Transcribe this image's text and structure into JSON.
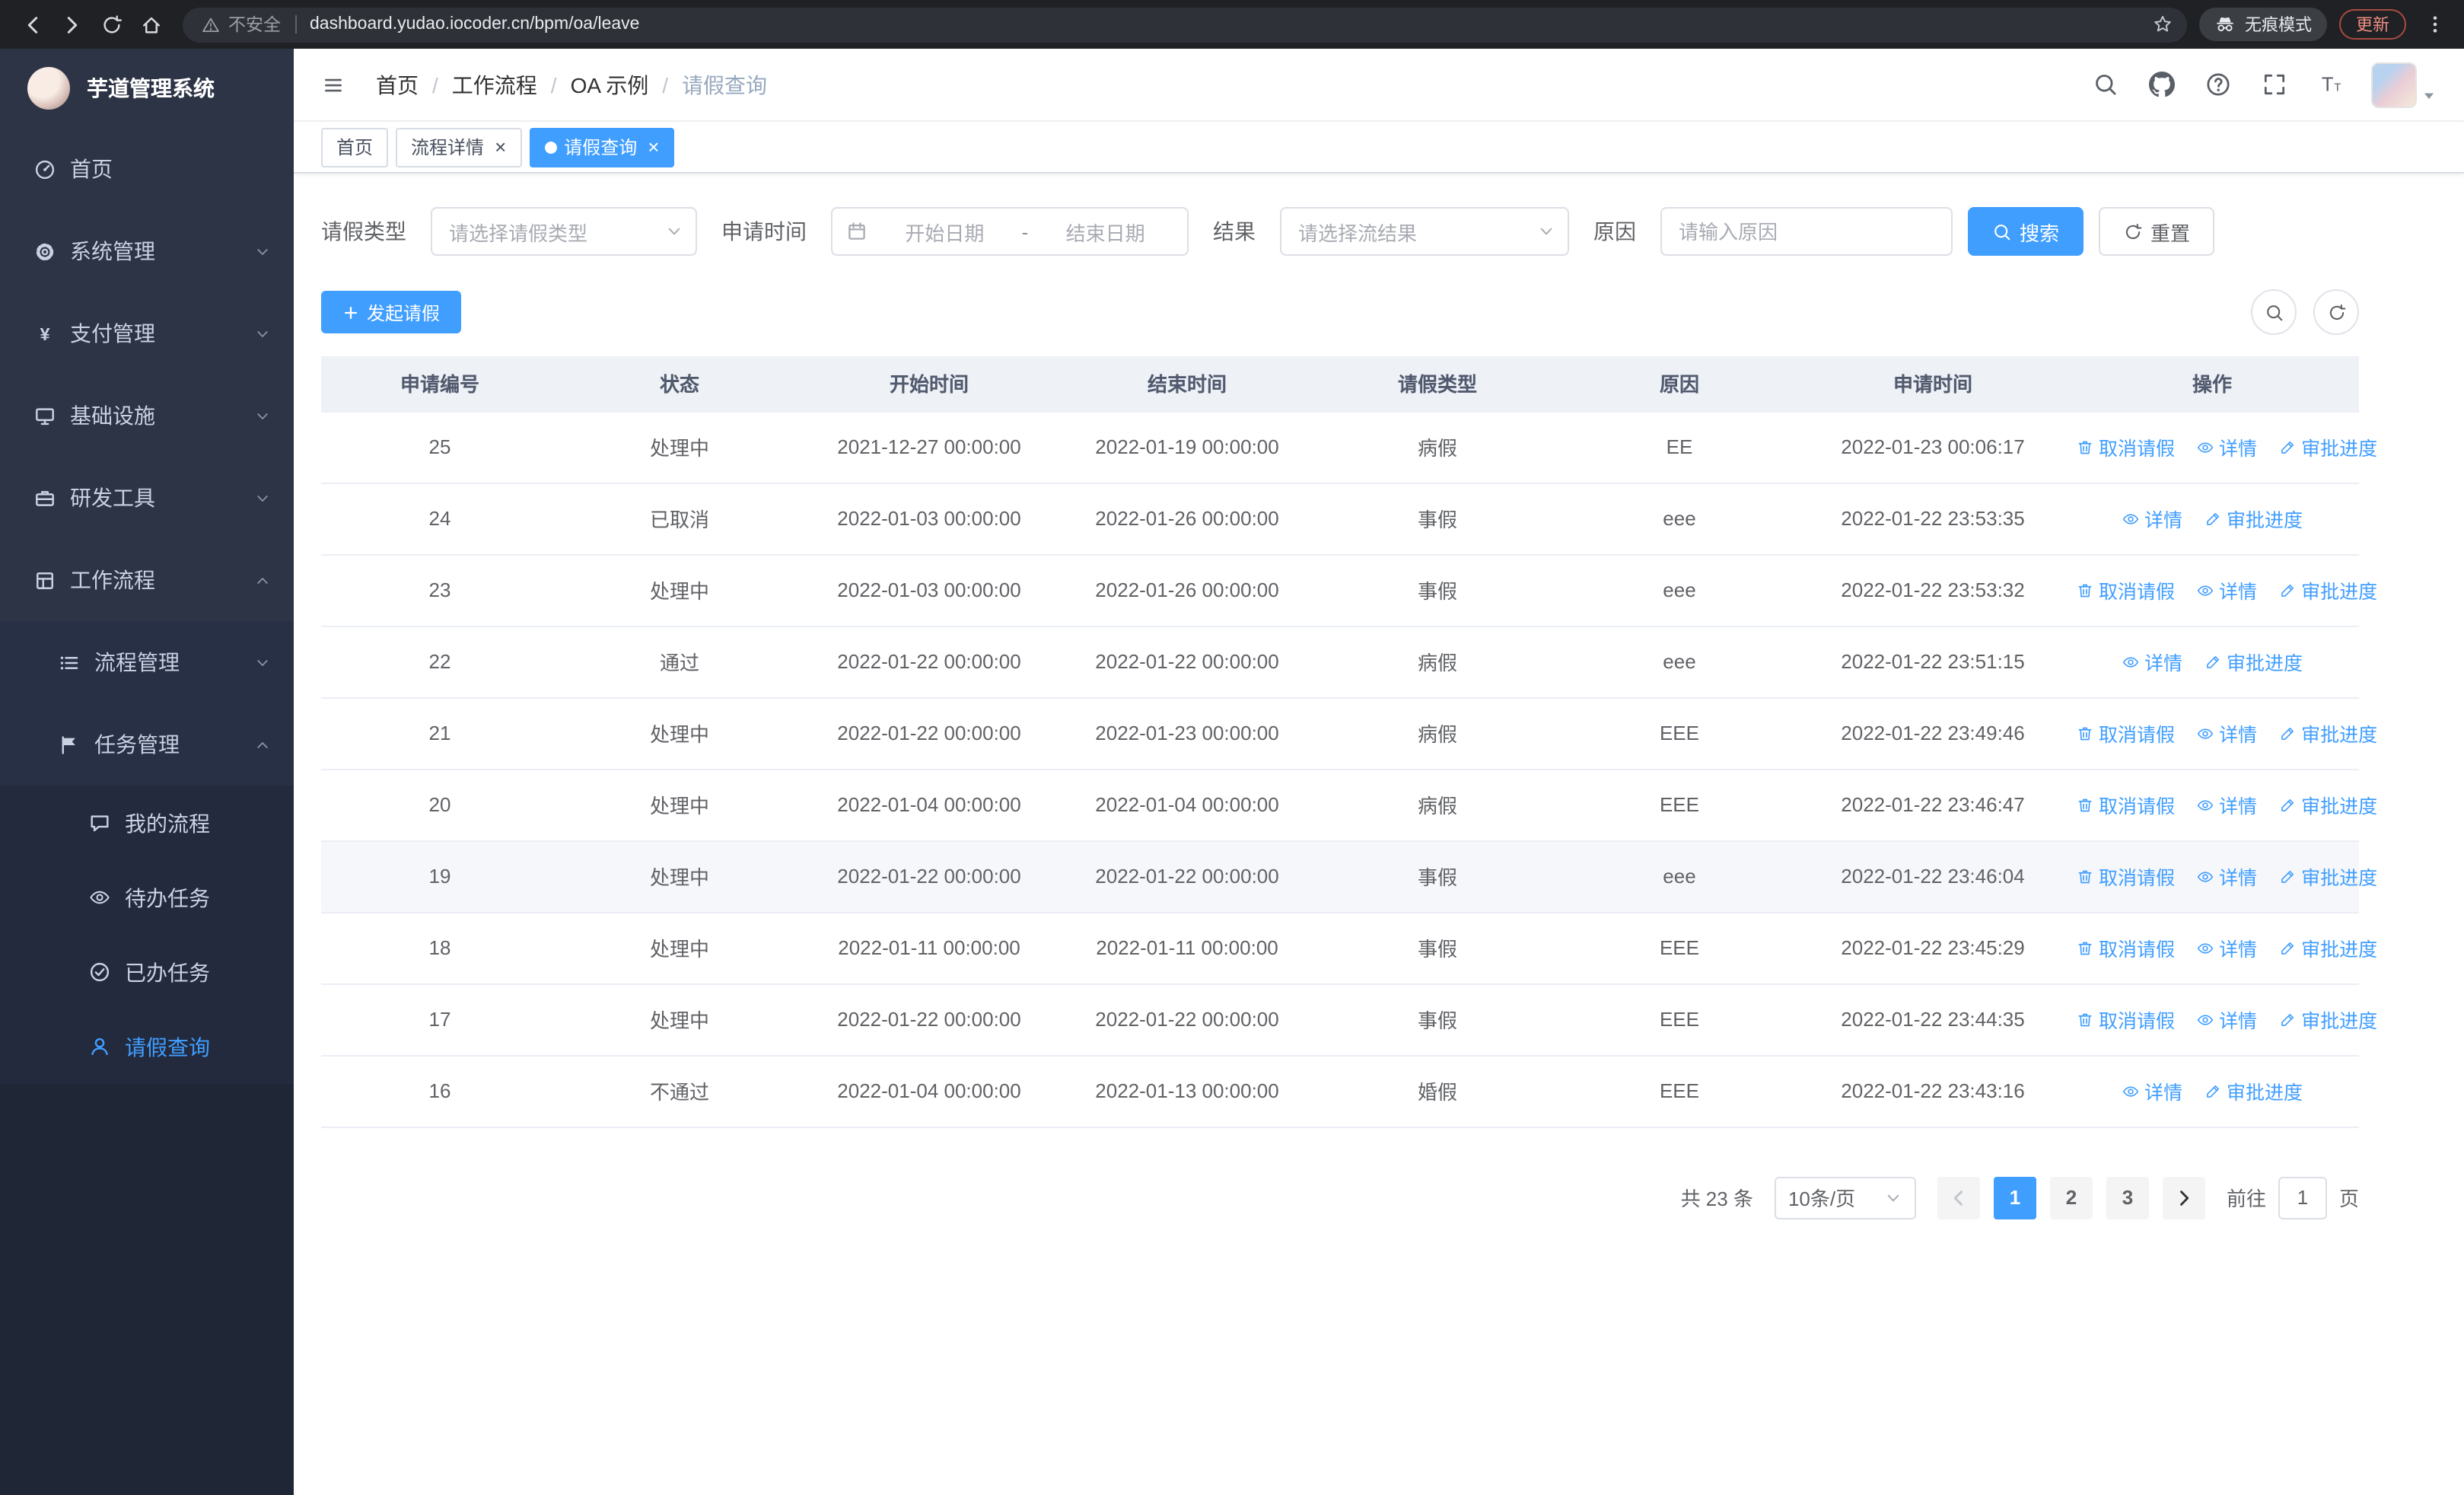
{
  "colors": {
    "primary": "#409eff"
  },
  "browser": {
    "security_label": "不安全",
    "url": "dashboard.yudao.iocoder.cn/bpm/oa/leave",
    "incognito_label": "无痕模式",
    "update_label": "更新"
  },
  "sidebar": {
    "app_title": "芋道管理系统",
    "items": [
      {
        "key": "home",
        "label": "首页",
        "icon": "dashboard-icon",
        "level": 1
      },
      {
        "key": "system",
        "label": "系统管理",
        "icon": "gear-icon",
        "level": 1,
        "chevron": "down"
      },
      {
        "key": "payment",
        "label": "支付管理",
        "icon": "yen-icon",
        "level": 1,
        "chevron": "down"
      },
      {
        "key": "infrastructure",
        "label": "基础设施",
        "icon": "monitor-icon",
        "level": 1,
        "chevron": "down"
      },
      {
        "key": "devtools",
        "label": "研发工具",
        "icon": "briefcase-icon",
        "level": 1,
        "chevron": "down"
      },
      {
        "key": "workflow",
        "label": "工作流程",
        "icon": "grid-icon",
        "level": 1,
        "chevron": "up"
      },
      {
        "key": "process-mgmt",
        "label": "流程管理",
        "icon": "list-icon",
        "level": 2,
        "chevron": "down"
      },
      {
        "key": "task-mgmt",
        "label": "任务管理",
        "icon": "flag-icon",
        "level": 2,
        "chevron": "up"
      },
      {
        "key": "my-process",
        "label": "我的流程",
        "icon": "chat-icon",
        "level": 3
      },
      {
        "key": "todo-tasks",
        "label": "待办任务",
        "icon": "eye-icon",
        "level": 3
      },
      {
        "key": "done-tasks",
        "label": "已办任务",
        "icon": "check-circle-icon",
        "level": 3
      },
      {
        "key": "leave-query",
        "label": "请假查询",
        "icon": "user-icon",
        "level": 3,
        "active": true
      }
    ]
  },
  "header": {
    "breadcrumb": [
      "首页",
      "工作流程",
      "OA 示例",
      "请假查询"
    ]
  },
  "tabs": [
    {
      "key": "home",
      "label": "首页",
      "closable": false,
      "active": false
    },
    {
      "key": "process-detail",
      "label": "流程详情",
      "closable": true,
      "active": false
    },
    {
      "key": "leave-query",
      "label": "请假查询",
      "closable": true,
      "active": true
    }
  ],
  "filters": {
    "leave_type_label": "请假类型",
    "leave_type_placeholder": "请选择请假类型",
    "apply_time_label": "申请时间",
    "start_date_placeholder": "开始日期",
    "date_separator": "-",
    "end_date_placeholder": "结束日期",
    "result_label": "结果",
    "result_placeholder": "请选择流结果",
    "reason_label": "原因",
    "reason_placeholder": "请输入原因",
    "search_button": "搜索",
    "reset_button": "重置"
  },
  "toolbar": {
    "create_button": "发起请假"
  },
  "table": {
    "columns": [
      "申请编号",
      "状态",
      "开始时间",
      "结束时间",
      "请假类型",
      "原因",
      "申请时间",
      "操作"
    ],
    "action_labels": {
      "cancel": "取消请假",
      "detail": "详情",
      "progress": "审批进度"
    },
    "rows": [
      {
        "id": "25",
        "status": "处理中",
        "start": "2021-12-27 00:00:00",
        "end": "2022-01-19 00:00:00",
        "type": "病假",
        "reason": "EE",
        "applied": "2022-01-23 00:06:17",
        "actions": [
          "cancel",
          "detail",
          "progress"
        ]
      },
      {
        "id": "24",
        "status": "已取消",
        "start": "2022-01-03 00:00:00",
        "end": "2022-01-26 00:00:00",
        "type": "事假",
        "reason": "eee",
        "applied": "2022-01-22 23:53:35",
        "actions": [
          "detail",
          "progress"
        ]
      },
      {
        "id": "23",
        "status": "处理中",
        "start": "2022-01-03 00:00:00",
        "end": "2022-01-26 00:00:00",
        "type": "事假",
        "reason": "eee",
        "applied": "2022-01-22 23:53:32",
        "actions": [
          "cancel",
          "detail",
          "progress"
        ]
      },
      {
        "id": "22",
        "status": "通过",
        "start": "2022-01-22 00:00:00",
        "end": "2022-01-22 00:00:00",
        "type": "病假",
        "reason": "eee",
        "applied": "2022-01-22 23:51:15",
        "actions": [
          "detail",
          "progress"
        ]
      },
      {
        "id": "21",
        "status": "处理中",
        "start": "2022-01-22 00:00:00",
        "end": "2022-01-23 00:00:00",
        "type": "病假",
        "reason": "EEE",
        "applied": "2022-01-22 23:49:46",
        "actions": [
          "cancel",
          "detail",
          "progress"
        ]
      },
      {
        "id": "20",
        "status": "处理中",
        "start": "2022-01-04 00:00:00",
        "end": "2022-01-04 00:00:00",
        "type": "病假",
        "reason": "EEE",
        "applied": "2022-01-22 23:46:47",
        "actions": [
          "cancel",
          "detail",
          "progress"
        ]
      },
      {
        "id": "19",
        "status": "处理中",
        "start": "2022-01-22 00:00:00",
        "end": "2022-01-22 00:00:00",
        "type": "事假",
        "reason": "eee",
        "applied": "2022-01-22 23:46:04",
        "actions": [
          "cancel",
          "detail",
          "progress"
        ],
        "hover": true
      },
      {
        "id": "18",
        "status": "处理中",
        "start": "2022-01-11 00:00:00",
        "end": "2022-01-11 00:00:00",
        "type": "事假",
        "reason": "EEE",
        "applied": "2022-01-22 23:45:29",
        "actions": [
          "cancel",
          "detail",
          "progress"
        ]
      },
      {
        "id": "17",
        "status": "处理中",
        "start": "2022-01-22 00:00:00",
        "end": "2022-01-22 00:00:00",
        "type": "事假",
        "reason": "EEE",
        "applied": "2022-01-22 23:44:35",
        "actions": [
          "cancel",
          "detail",
          "progress"
        ]
      },
      {
        "id": "16",
        "status": "不通过",
        "start": "2022-01-04 00:00:00",
        "end": "2022-01-13 00:00:00",
        "type": "婚假",
        "reason": "EEE",
        "applied": "2022-01-22 23:43:16",
        "actions": [
          "detail",
          "progress"
        ]
      }
    ]
  },
  "pagination": {
    "total_text": "共 23 条",
    "page_size": "10条/页",
    "pages": [
      "1",
      "2",
      "3"
    ],
    "active_page": "1",
    "goto_label": "前往",
    "goto_value": "1",
    "goto_suffix": "页"
  }
}
